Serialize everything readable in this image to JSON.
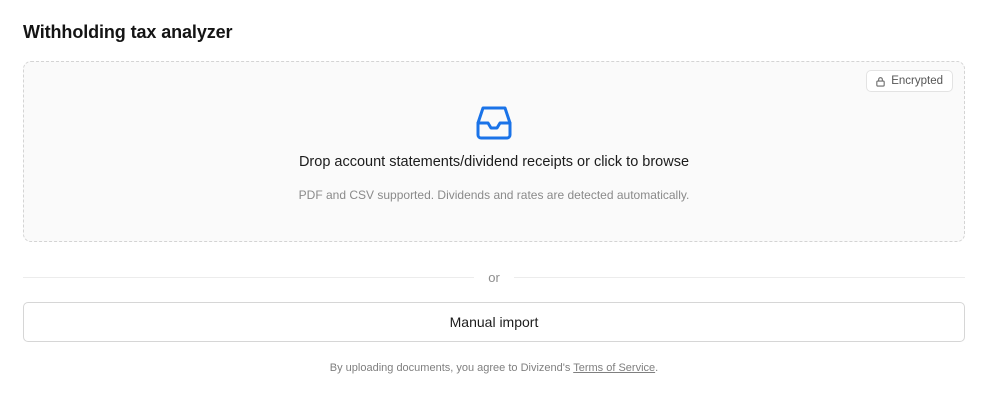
{
  "header": {
    "title": "Withholding tax analyzer"
  },
  "dropzone": {
    "badge_label": "Encrypted",
    "badge_icon": "lock-icon",
    "main_icon": "inbox-icon",
    "primary_text": "Drop account statements/dividend receipts or click to browse",
    "secondary_text": "PDF and CSV supported. Dividends and rates are detected automatically."
  },
  "divider": {
    "label": "or"
  },
  "actions": {
    "manual_import_label": "Manual import"
  },
  "footer": {
    "prefix": "By uploading documents, you agree to Divizend's ",
    "link_label": "Terms of Service",
    "suffix": "."
  },
  "colors": {
    "accent": "#1a73e8",
    "dropzone_background": "#fafafa",
    "border": "#d6d6d6"
  }
}
